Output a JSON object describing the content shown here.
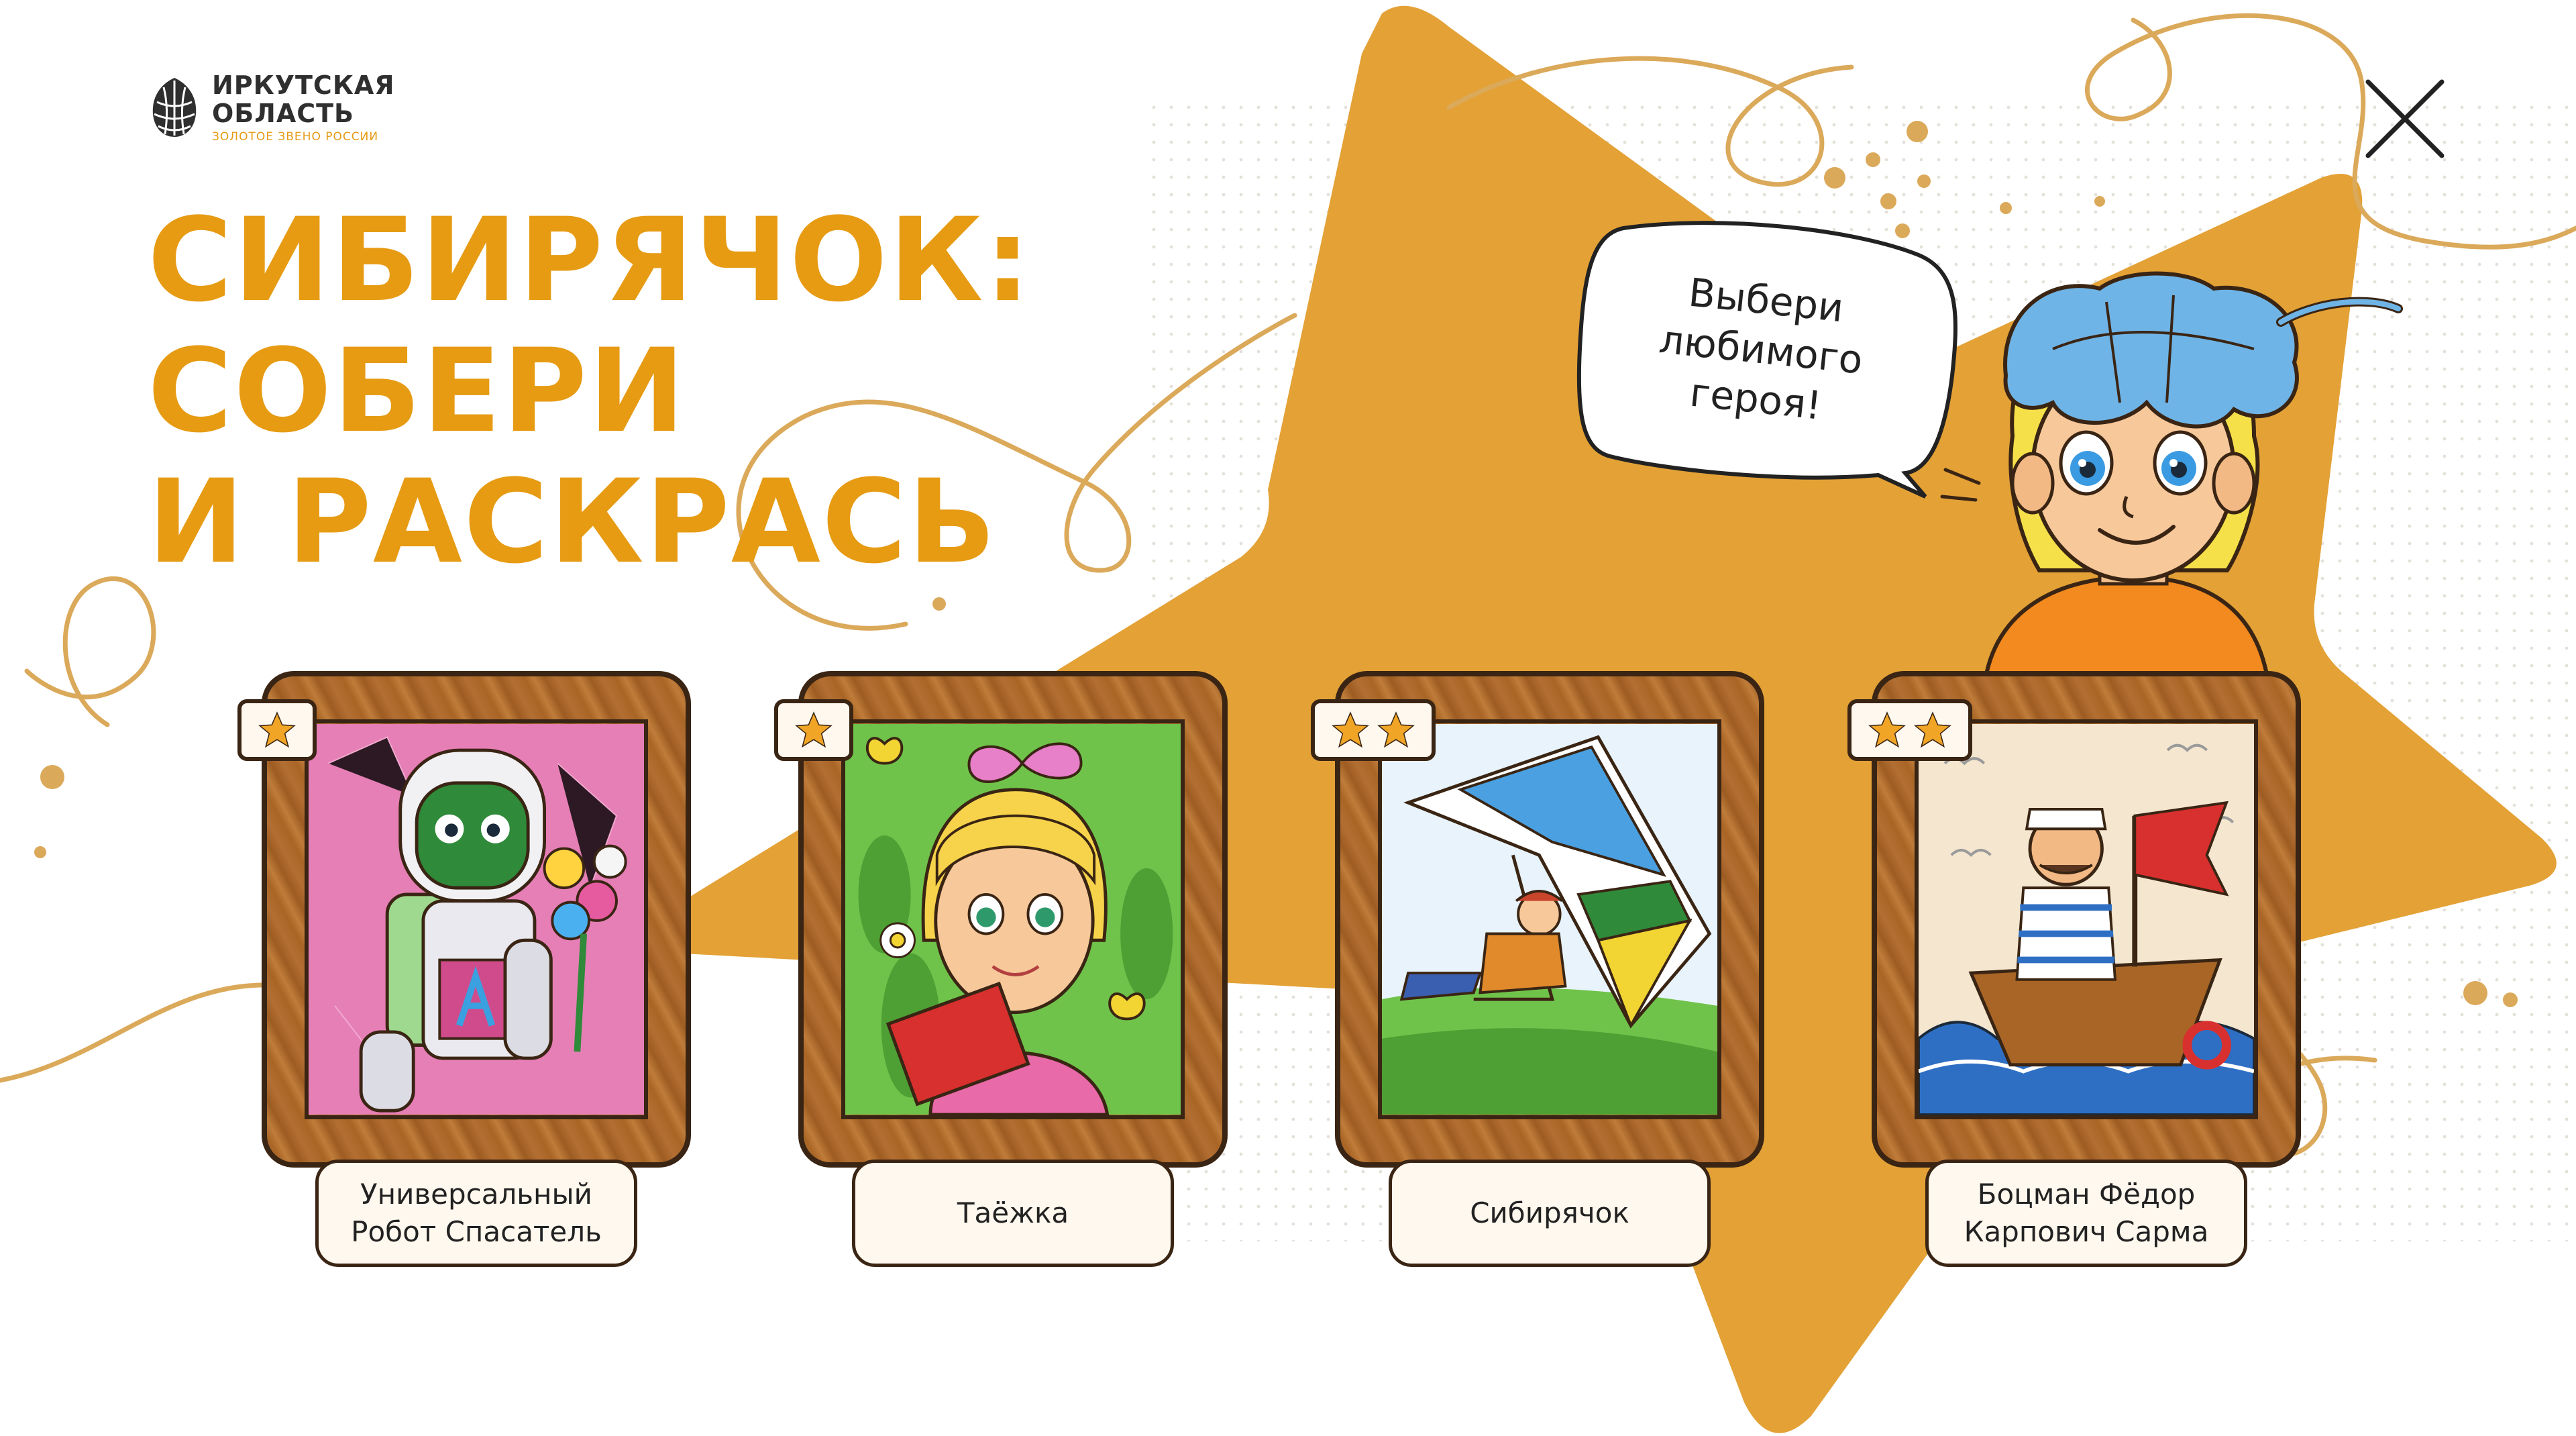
{
  "logo": {
    "line1": "ИРКУТСКАЯ",
    "line2": "ОБЛАСТЬ",
    "tagline": "ЗОЛОТОЕ ЗВЕНО РОССИИ"
  },
  "title": {
    "line1": "СИБИРЯЧОК:",
    "line2": "СОБЕРИ",
    "line3": "И РАСКРАСЬ"
  },
  "speech_bubble": {
    "line1": "Выбери",
    "line2": "любимого",
    "line3": "героя!"
  },
  "colors": {
    "accent": "#e69b13",
    "star": "#e3a136",
    "wood": "#a86525",
    "outline": "#3a2514",
    "plate": "#fff8ee"
  },
  "heroes": [
    {
      "name": "Универсальный Робот Спасатель",
      "difficulty": 1,
      "illustration": "robot-illustration"
    },
    {
      "name": "Таёжка",
      "difficulty": 1,
      "illustration": "girl-illustration"
    },
    {
      "name": "Сибирячок",
      "difficulty": 2,
      "illustration": "hang-glider-illustration"
    },
    {
      "name": "Боцман Фёдор Карпович Сарма",
      "difficulty": 2,
      "illustration": "boatswain-illustration"
    }
  ]
}
